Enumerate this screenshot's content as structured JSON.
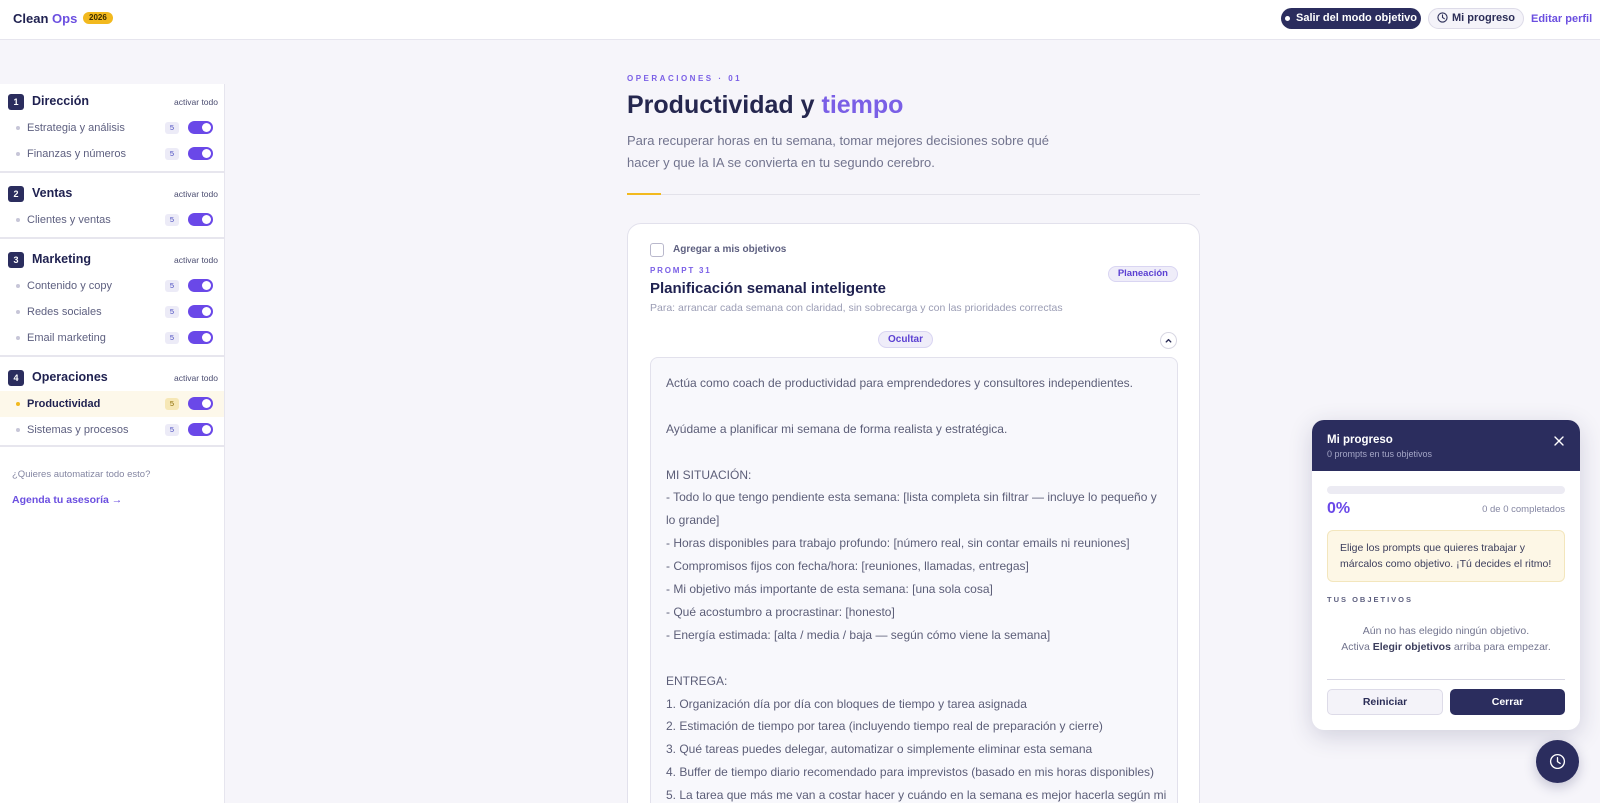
{
  "header": {
    "brand_part1": "Clean",
    "brand_part2": "Ops",
    "brand_year": "2026",
    "exit_goal_mode": "Salir del modo objetivo",
    "my_progress": "Mi progreso",
    "edit_profile": "Editar perfil"
  },
  "sidebar": {
    "activate_all": "activar todo",
    "groups": [
      {
        "num": "1",
        "title": "Dirección",
        "items": [
          {
            "label": "Estrategia y análisis",
            "count": "5",
            "enabled": true
          },
          {
            "label": "Finanzas y números",
            "count": "5",
            "enabled": true
          }
        ]
      },
      {
        "num": "2",
        "title": "Ventas",
        "items": [
          {
            "label": "Clientes y ventas",
            "count": "5",
            "enabled": true
          }
        ]
      },
      {
        "num": "3",
        "title": "Marketing",
        "items": [
          {
            "label": "Contenido y copy",
            "count": "5",
            "enabled": true
          },
          {
            "label": "Redes sociales",
            "count": "5",
            "enabled": true
          },
          {
            "label": "Email marketing",
            "count": "5",
            "enabled": true
          }
        ]
      },
      {
        "num": "4",
        "title": "Operaciones",
        "items": [
          {
            "label": "Productividad",
            "count": "5",
            "enabled": true,
            "active": true
          },
          {
            "label": "Sistemas y procesos",
            "count": "5",
            "enabled": true
          }
        ]
      }
    ],
    "question": "¿Quieres automatizar todo esto?",
    "cta": "Agenda tu asesoría →"
  },
  "main": {
    "eyebrow": "OPERACIONES · 01",
    "title_part1": "Productividad y",
    "title_part2": "tiempo",
    "lead": "Para recuperar horas en tu semana, tomar mejores decisiones sobre qué hacer y que la IA se convierta en tu segundo cerebro.",
    "card": {
      "add_to_goals": "Agregar a mis objetivos",
      "prompt_number": "PROMPT 31",
      "tag": "Planeación",
      "title": "Planificación semanal inteligente",
      "subtitle": "Para: arrancar cada semana con claridad, sin sobrecarga y con las prioridades correctas",
      "hide_label": "Ocultar",
      "prompt_lines": [
        "Actúa como coach de productividad para emprendedores y consultores independientes.",
        "",
        "Ayúdame a planificar mi semana de forma realista y estratégica.",
        "",
        "MI SITUACIÓN:",
        "- Todo lo que tengo pendiente esta semana: [lista completa sin filtrar — incluye lo pequeño y lo grande]",
        "- Horas disponibles para trabajo profundo: [número real, sin contar emails ni reuniones]",
        "- Compromisos fijos con fecha/hora: [reuniones, llamadas, entregas]",
        "- Mi objetivo más importante de esta semana: [una sola cosa]",
        "- Qué acostumbro a procrastinar: [honesto]",
        "- Energía estimada: [alta / media / baja — según cómo viene la semana]",
        "",
        "ENTREGA:",
        "1. Organización día por día con bloques de tiempo y tarea asignada",
        "2. Estimación de tiempo por tarea (incluyendo tiempo real de preparación y cierre)",
        "3. Qué tareas puedes delegar, automatizar o simplemente eliminar esta semana",
        "4. Buffer de tiempo diario recomendado para imprevistos (basado en mis horas disponibles)",
        "5. La tarea que más me van a costar hacer y cuándo en la semana es mejor hacerla según mi"
      ]
    }
  },
  "progress_panel": {
    "title": "Mi progreso",
    "subtitle": "0 prompts en tus objetivos",
    "percent_label": "0%",
    "progress_fraction": 0,
    "completed_text": "0 de 0 completados",
    "hint": "Elige los prompts que quieres trabajar y márcalos como objetivo. ¡Tú decides el ritmo!",
    "goals_heading": "TUS OBJETIVOS",
    "empty_line1": "Aún no has elegido ningún objetivo.",
    "empty_line2_pre": "Activa",
    "empty_line2_bold": "Elegir objetivos",
    "empty_line2_post": "arriba para empezar.",
    "reset_button": "Reiniciar",
    "close_button": "Cerrar"
  },
  "colors": {
    "accent": "#6a48e8",
    "navy": "#2b2d5e",
    "highlight": "#f2b91e"
  },
  "icons": [
    "clock-icon",
    "chevron-up-icon",
    "close-icon"
  ]
}
